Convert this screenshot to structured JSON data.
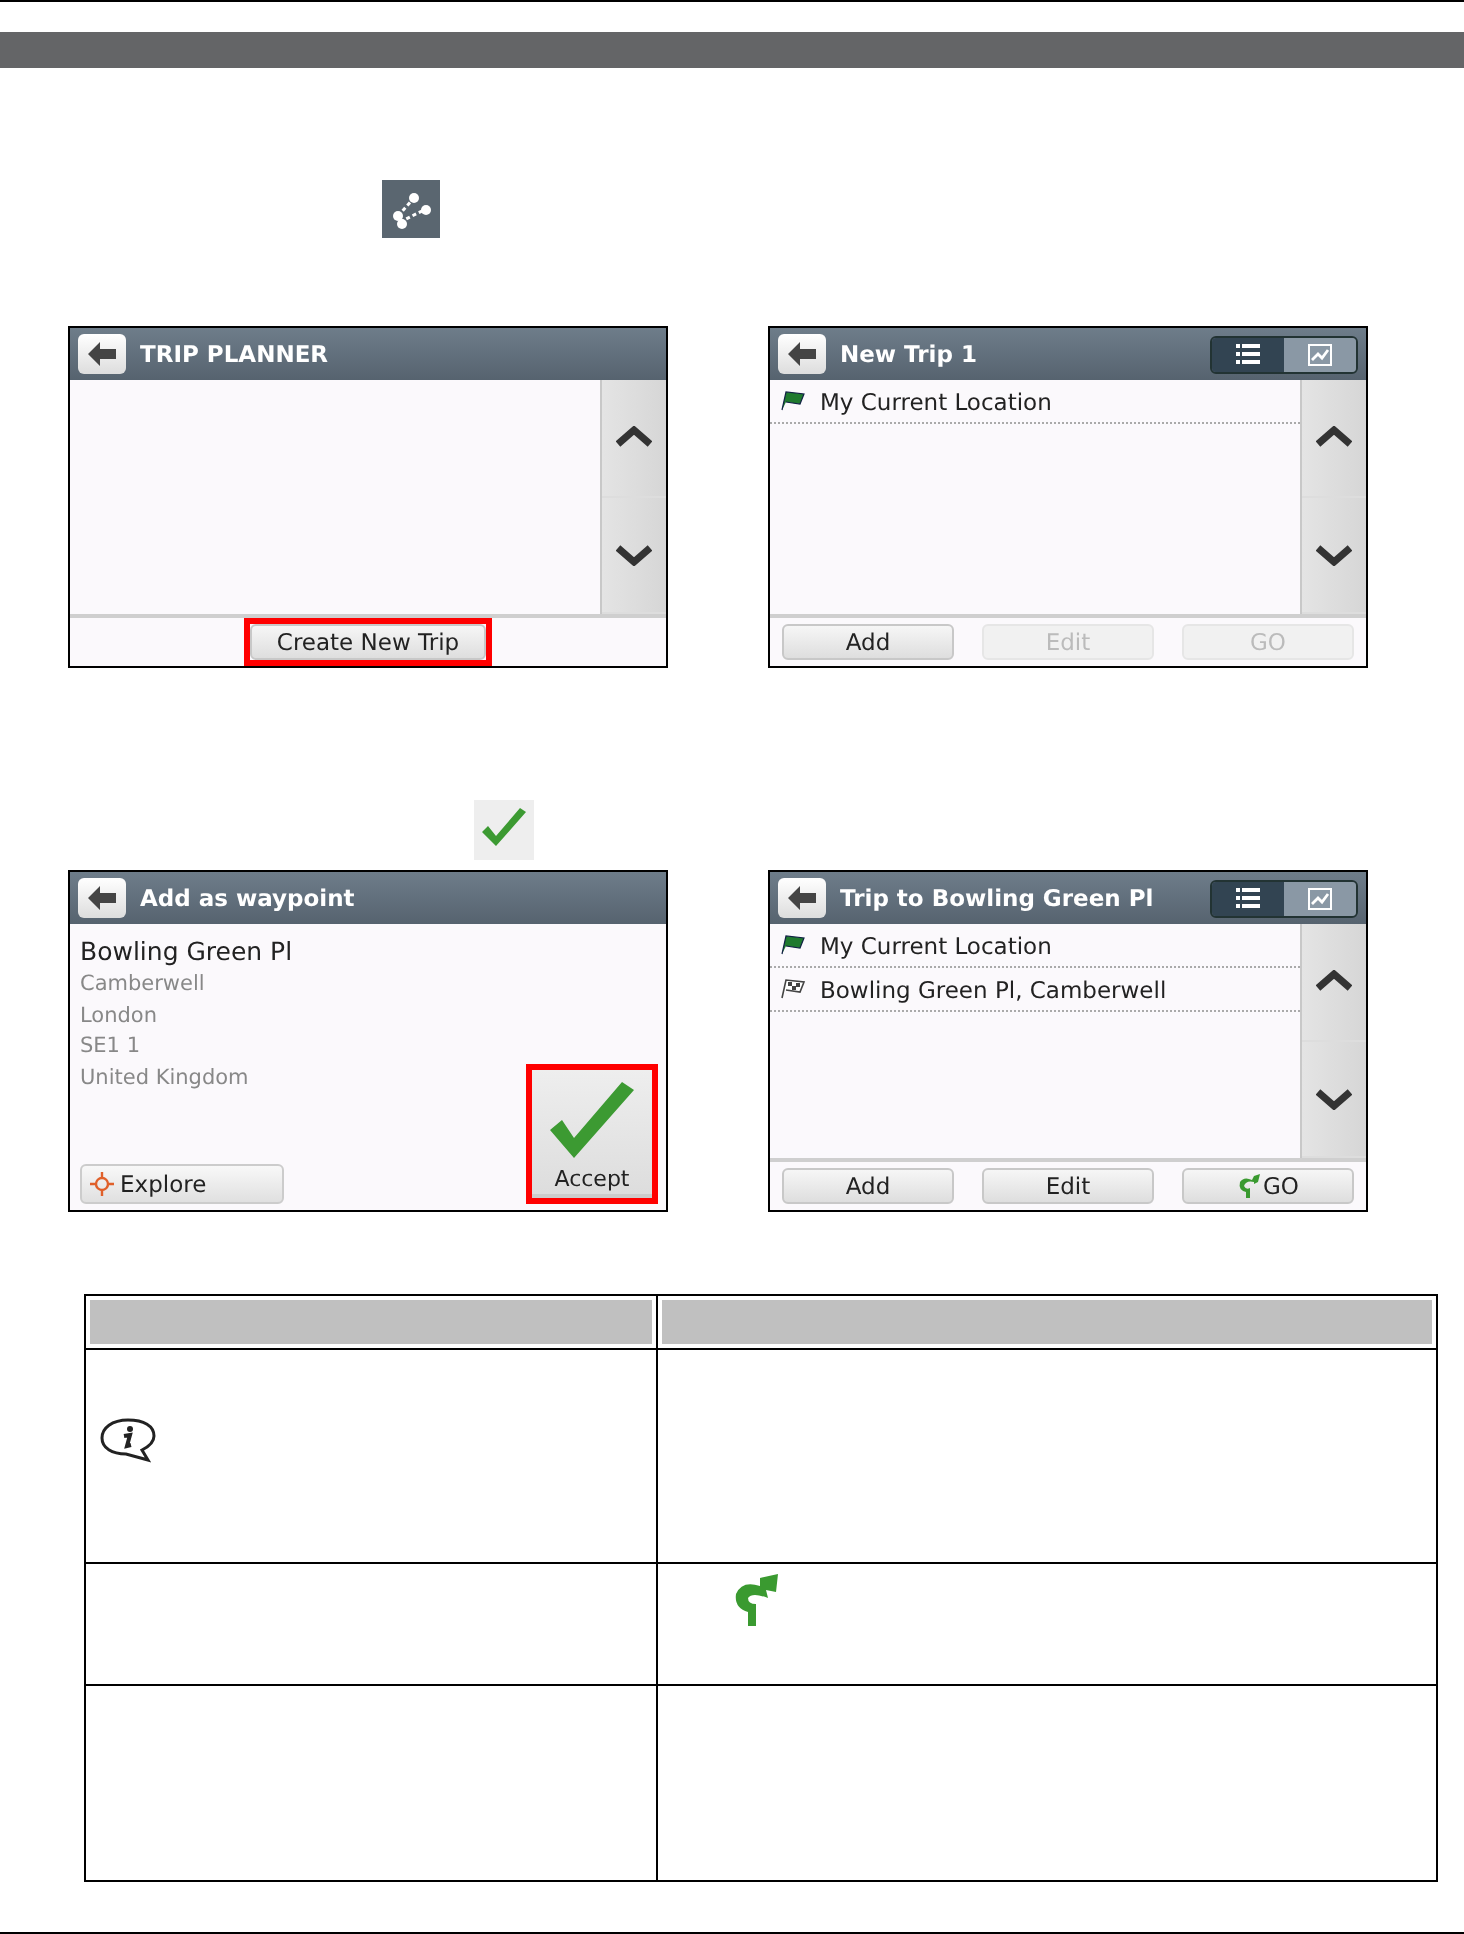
{
  "screens": [
    {
      "kind": "list",
      "title": "TRIP PLANNER",
      "buttons": [
        {
          "label": "Create New Trip",
          "kind": "plain",
          "disabled": false,
          "highlighted": true
        }
      ]
    },
    {
      "kind": "list",
      "title": "New Trip 1",
      "view_modes": [
        {
          "kind": "list",
          "selected": true
        },
        {
          "kind": "map",
          "selected": false
        }
      ],
      "items": [
        {
          "label": "My Current Location",
          "kind": "start"
        }
      ],
      "buttons": [
        {
          "label": "Add",
          "kind": "plain",
          "disabled": false,
          "highlighted": false
        },
        {
          "label": "Edit",
          "kind": "plain",
          "disabled": true,
          "highlighted": false
        },
        {
          "label": "GO",
          "kind": "plain",
          "disabled": true,
          "highlighted": false
        }
      ]
    },
    {
      "kind": "detail",
      "title": "Add as waypoint",
      "name": "Bowling Green Pl",
      "address": [
        "Camberwell",
        "London",
        "SE1 1",
        "United Kingdom"
      ],
      "buttons": [
        {
          "label": "Explore",
          "kind": "explore",
          "disabled": false,
          "highlighted": false
        },
        {
          "label": "Accept",
          "kind": "accept",
          "disabled": false,
          "highlighted": true
        }
      ]
    },
    {
      "kind": "list",
      "title": "Trip to Bowling Green Pl",
      "view_modes": [
        {
          "kind": "list",
          "selected": true
        },
        {
          "kind": "map",
          "selected": false
        }
      ],
      "items": [
        {
          "label": "My Current Location",
          "kind": "start"
        },
        {
          "label": "Bowling Green Pl, Camberwell",
          "kind": "destination"
        }
      ],
      "buttons": [
        {
          "label": "Add",
          "kind": "plain",
          "disabled": false,
          "highlighted": false
        },
        {
          "label": "Edit",
          "kind": "plain",
          "disabled": false,
          "highlighted": false
        },
        {
          "label": "GO",
          "kind": "go",
          "disabled": false,
          "highlighted": false
        }
      ]
    }
  ]
}
